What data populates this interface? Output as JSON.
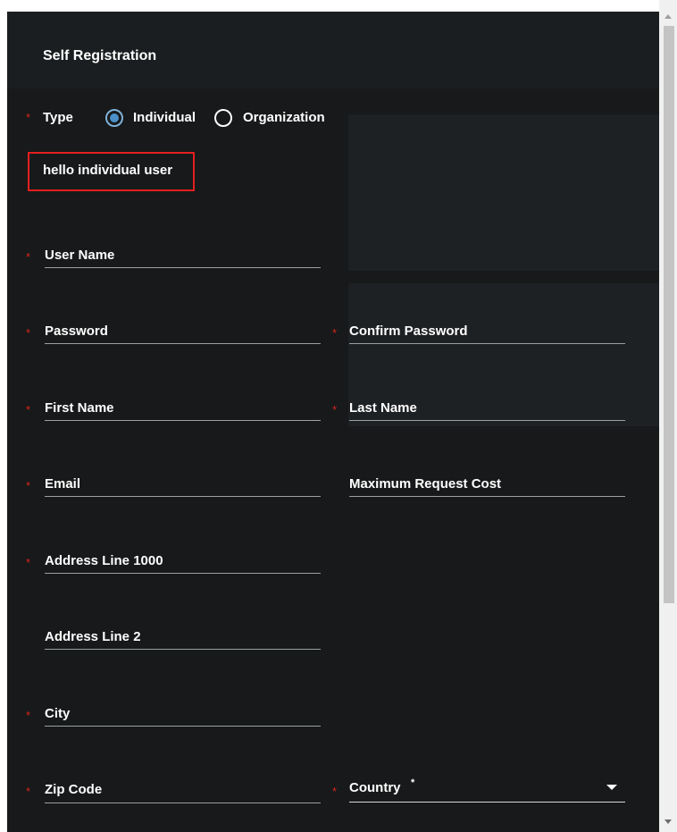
{
  "dialog": {
    "title": "Self Registration"
  },
  "type_field": {
    "label": "Type",
    "options": [
      "Individual",
      "Organization"
    ],
    "selected": "Individual"
  },
  "note": "hello individual user",
  "fields": {
    "user_name": "User Name",
    "password": "Password",
    "confirm_password": "Confirm Password",
    "first_name": "First Name",
    "last_name": "Last Name",
    "email": "Email",
    "max_request_cost": "Maximum Request Cost",
    "address_line_1": "Address Line 1000",
    "address_line_2": "Address Line 2",
    "city": "City",
    "zip_code": "Zip Code",
    "country": "Country",
    "country_required_mark": "*"
  },
  "required_mark": "*",
  "colors": {
    "background": "#17191a",
    "required": "#d8251e",
    "highlight_border": "#e41f1f",
    "radio_selected": "#4a8fc8"
  }
}
